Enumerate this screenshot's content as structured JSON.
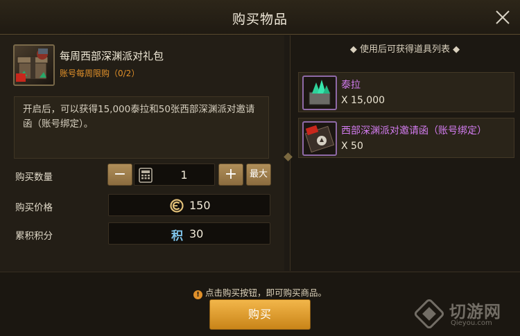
{
  "dialog": {
    "title": "购买物品",
    "close_icon": "close-icon"
  },
  "item": {
    "name": "每周西部深渊派对礼包",
    "limit": "账号每周限购（0/2）",
    "description": "开启后，可以获得15,000泰拉和50张西部深渊派对邀请函（账号绑定）。"
  },
  "purchase": {
    "quantity_label": "购买数量",
    "decrement": "−",
    "increment": "+",
    "quantity": "1",
    "max_label": "最大",
    "price_label": "购买价格",
    "price": "150",
    "points_label": "累积积分",
    "points_icon": "积",
    "points": "30"
  },
  "rewards": {
    "title": "◆ 使用后可获得道具列表 ◆",
    "items": [
      {
        "name": "泰拉",
        "count": "X 15,000"
      },
      {
        "name": "西部深渊派对邀请函（账号绑定）",
        "count": "X 50"
      }
    ]
  },
  "footer": {
    "hint": "点击购买按钮，即可购买商品。",
    "buy_label": "购买"
  },
  "watermark": {
    "text": "切游网",
    "sub": "Qieyou.com"
  },
  "colors": {
    "accent_gold": "#f2b64a",
    "limit_orange": "#e0902a",
    "reward_purple": "#d37cf0"
  }
}
